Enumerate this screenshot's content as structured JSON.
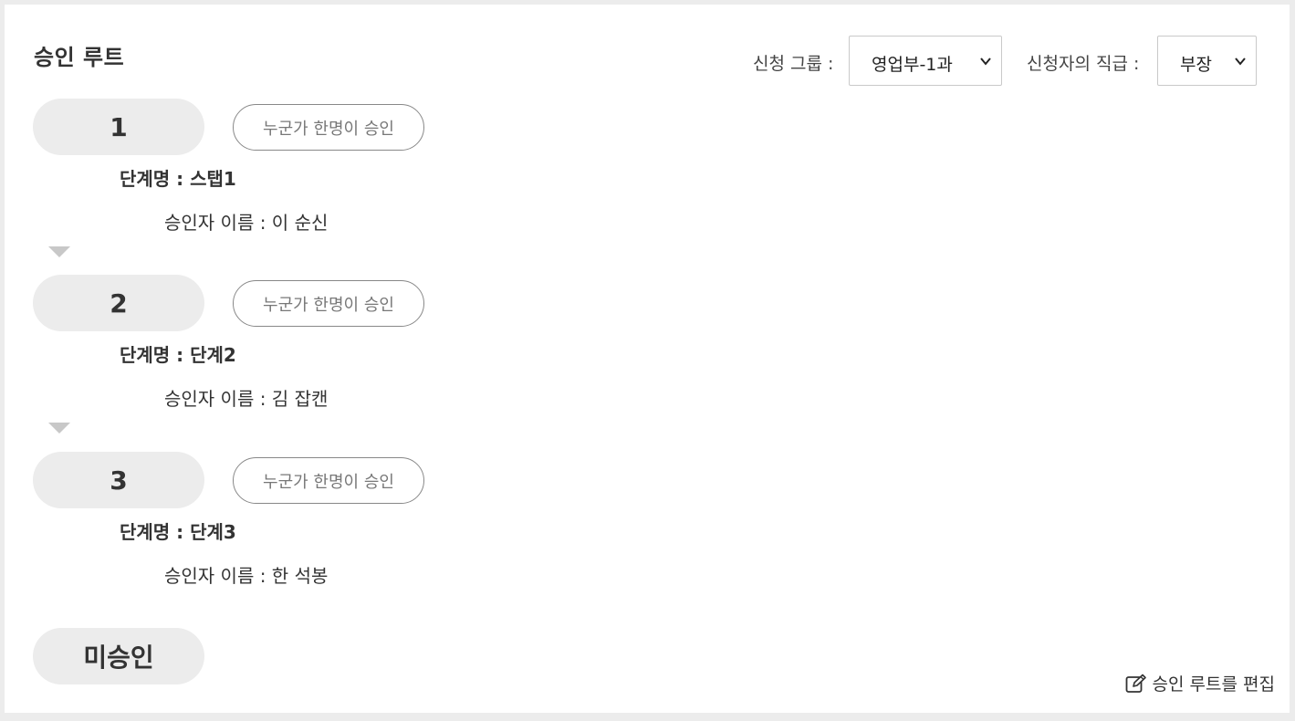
{
  "header": {
    "title": "승인 루트"
  },
  "filters": {
    "group_label": "신청 그룹 :",
    "group_value": "영업부-1과",
    "rank_label": "신청자의 직급 :",
    "rank_value": "부장"
  },
  "steps": [
    {
      "number": "1",
      "rule": "누군가 한명이 승인",
      "name": "단계명 : 스탭1",
      "approver": "승인자 이름 : 이 순신"
    },
    {
      "number": "2",
      "rule": "누군가 한명이 승인",
      "name": "단계명 : 단계2",
      "approver": "승인자 이름 : 김 잡캔"
    },
    {
      "number": "3",
      "rule": "누군가 한명이 승인",
      "name": "단계명 : 단계3",
      "approver": "승인자 이름 : 한 석봉"
    }
  ],
  "final_state": "미승인",
  "footer": {
    "edit_label": "승인 루트를 편집",
    "edit_icon": "edit-icon"
  }
}
